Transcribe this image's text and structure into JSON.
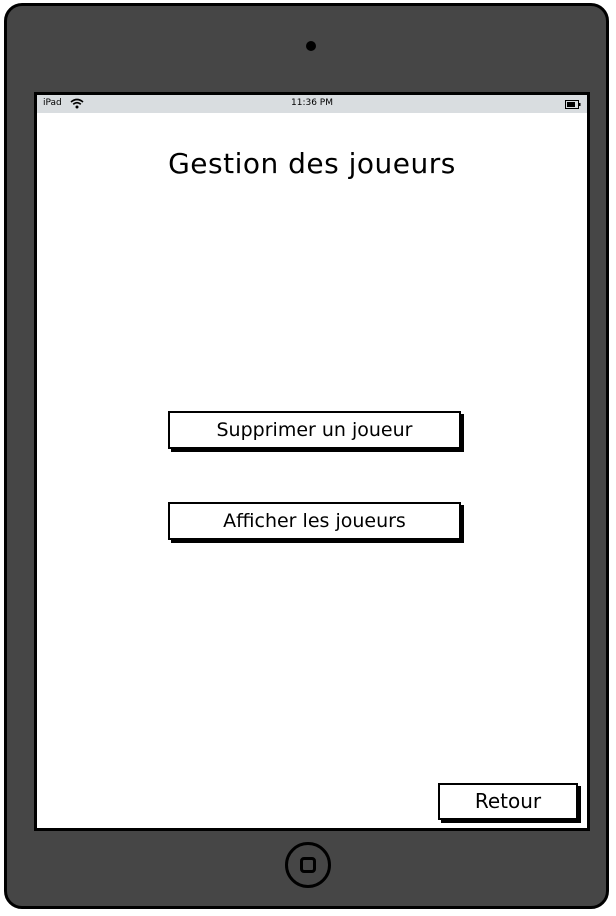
{
  "status_bar": {
    "device_label": "iPad",
    "time": "11:36 PM",
    "wifi_icon": "wifi-icon",
    "battery_icon": "battery-icon"
  },
  "screen": {
    "title": "Gestion des joueurs",
    "buttons": {
      "delete_player": "Supprimer un joueur",
      "show_players": "Afficher les joueurs",
      "back": "Retour"
    }
  },
  "device": {
    "frame_color": "#464646",
    "status_bar_color": "#d9dde0",
    "camera_icon": "camera-icon",
    "home_icon": "home-button-icon"
  }
}
